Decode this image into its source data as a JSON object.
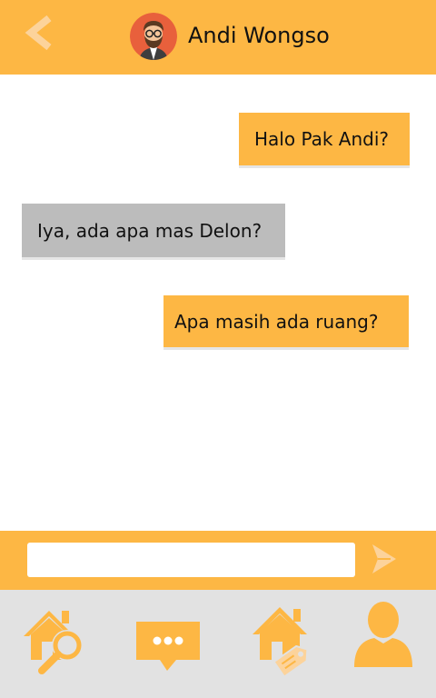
{
  "header": {
    "contact_name": "Andi Wongso",
    "back_icon": "chevron-left-icon",
    "avatar_icon": "bearded-man-avatar"
  },
  "messages": [
    {
      "direction": "outgoing",
      "text": "Halo Pak Andi?"
    },
    {
      "direction": "incoming",
      "text": "Iya, ada apa mas Delon?"
    },
    {
      "direction": "outgoing",
      "text": "Apa masih ada ruang?"
    }
  ],
  "composer": {
    "value": "",
    "placeholder": "",
    "send_icon": "send-arrow-icon"
  },
  "bottom_nav": [
    {
      "name": "search-home",
      "icon": "house-search-icon"
    },
    {
      "name": "chat",
      "icon": "chat-bubble-icon"
    },
    {
      "name": "listing",
      "icon": "house-tag-icon"
    },
    {
      "name": "profile",
      "icon": "user-icon"
    }
  ],
  "colors": {
    "accent": "#fdb744",
    "incoming_bubble": "#bcbcbc",
    "nav_background": "#e2e2e2",
    "icon_light": "#fcd39b"
  }
}
